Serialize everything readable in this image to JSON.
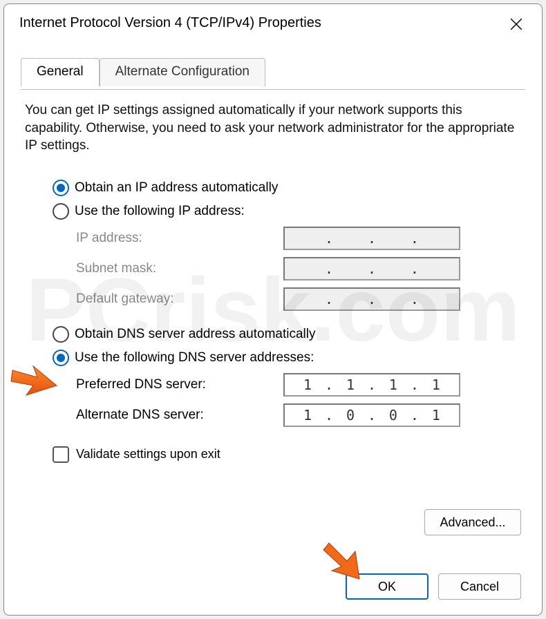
{
  "window": {
    "title": "Internet Protocol Version 4 (TCP/IPv4) Properties"
  },
  "tabs": {
    "general": "General",
    "alternate": "Alternate Configuration"
  },
  "intro": "You can get IP settings assigned automatically if your network supports this capability. Otherwise, you need to ask your network administrator for the appropriate IP settings.",
  "ip": {
    "obtain_auto": "Obtain an IP address automatically",
    "use_following": "Use the following IP address:",
    "address_label": "IP address:",
    "subnet_label": "Subnet mask:",
    "gateway_label": "Default gateway:"
  },
  "dns": {
    "obtain_auto": "Obtain DNS server address automatically",
    "use_following": "Use the following DNS server addresses:",
    "preferred_label": "Preferred DNS server:",
    "alternate_label": "Alternate DNS server:",
    "preferred_value": [
      "1",
      "1",
      "1",
      "1"
    ],
    "alternate_value": [
      "1",
      "0",
      "0",
      "1"
    ]
  },
  "validate_label": "Validate settings upon exit",
  "buttons": {
    "advanced": "Advanced...",
    "ok": "OK",
    "cancel": "Cancel"
  }
}
